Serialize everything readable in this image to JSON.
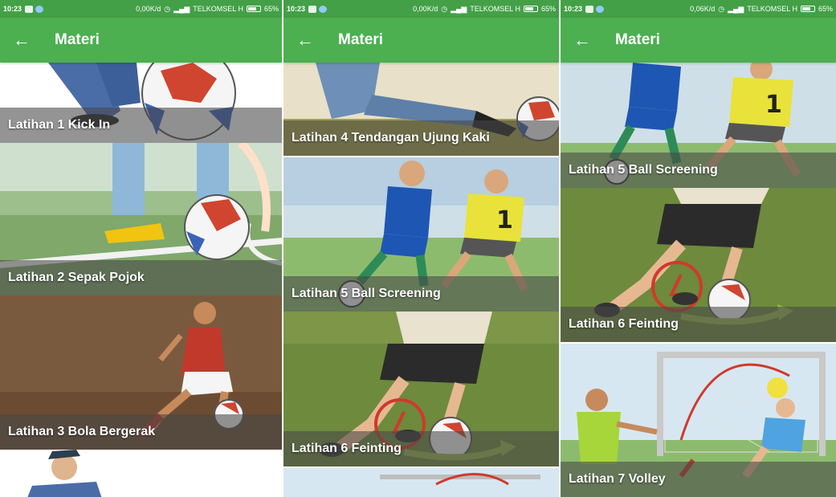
{
  "status": {
    "time": "10:23",
    "speeds": [
      "0,00K/d",
      "0,00K/d",
      "0,06K/d"
    ],
    "carrier": "TELKOMSEL H",
    "battery": "65%"
  },
  "appbar": {
    "back_icon": "←",
    "title": "Materi"
  },
  "panels": [
    {
      "items": [
        {
          "label": "Latihan 1  Kick In"
        },
        {
          "label": "Latihan 2  Sepak Pojok"
        },
        {
          "label": "Latihan 3  Bola Bergerak"
        }
      ]
    },
    {
      "items": [
        {
          "label": "Latihan 4  Tendangan Ujung Kaki"
        },
        {
          "label": "Latihan 5  Ball Screening"
        },
        {
          "label": "Latihan 6  Feinting"
        }
      ]
    },
    {
      "items": [
        {
          "label": "Latihan 5  Ball Screening"
        },
        {
          "label": "Latihan 6  Feinting"
        },
        {
          "label": "Latihan 7  Volley"
        }
      ]
    }
  ],
  "colors": {
    "status_bar": "#43a047",
    "app_bar": "#4caf50",
    "label_overlay": "rgba(70,70,70,0.58)"
  }
}
